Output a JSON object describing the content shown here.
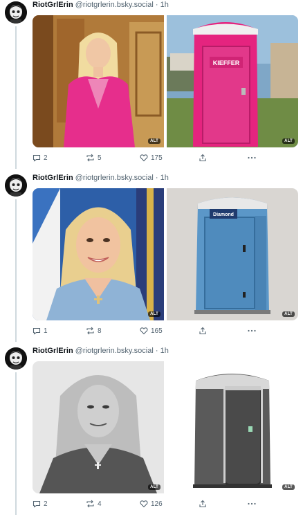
{
  "posts": [
    {
      "author": "RiotGrlErin",
      "handle": "@riotgrlerin.bsky.social",
      "sep": "·",
      "time": "1h",
      "replies": "2",
      "reposts": "5",
      "likes": "175",
      "images": [
        {
          "kind": "woman-pink",
          "alt_badge": "ALT"
        },
        {
          "kind": "porta-pink",
          "alt_badge": "ALT",
          "label": "KIEFFER"
        }
      ]
    },
    {
      "author": "RiotGrlErin",
      "handle": "@riotgrlerin.bsky.social",
      "sep": "·",
      "time": "1h",
      "replies": "1",
      "reposts": "8",
      "likes": "165",
      "images": [
        {
          "kind": "woman-blue",
          "alt_badge": "ALT"
        },
        {
          "kind": "porta-blue",
          "alt_badge": "ALT",
          "label": "Diamond"
        }
      ]
    },
    {
      "author": "RiotGrlErin",
      "handle": "@riotgrlerin.bsky.social",
      "sep": "·",
      "time": "1h",
      "replies": "2",
      "reposts": "4",
      "likes": "126",
      "images": [
        {
          "kind": "woman-bw",
          "alt_badge": "ALT"
        },
        {
          "kind": "porta-grey",
          "alt_badge": "ALT"
        }
      ]
    }
  ],
  "icons": {
    "reply": "reply-icon",
    "repost": "repost-icon",
    "like": "heart-icon",
    "share": "share-icon",
    "more": "more-icon"
  },
  "colors": {
    "text": "#0f1419",
    "muted": "#536471",
    "line": "#cfd9de"
  }
}
